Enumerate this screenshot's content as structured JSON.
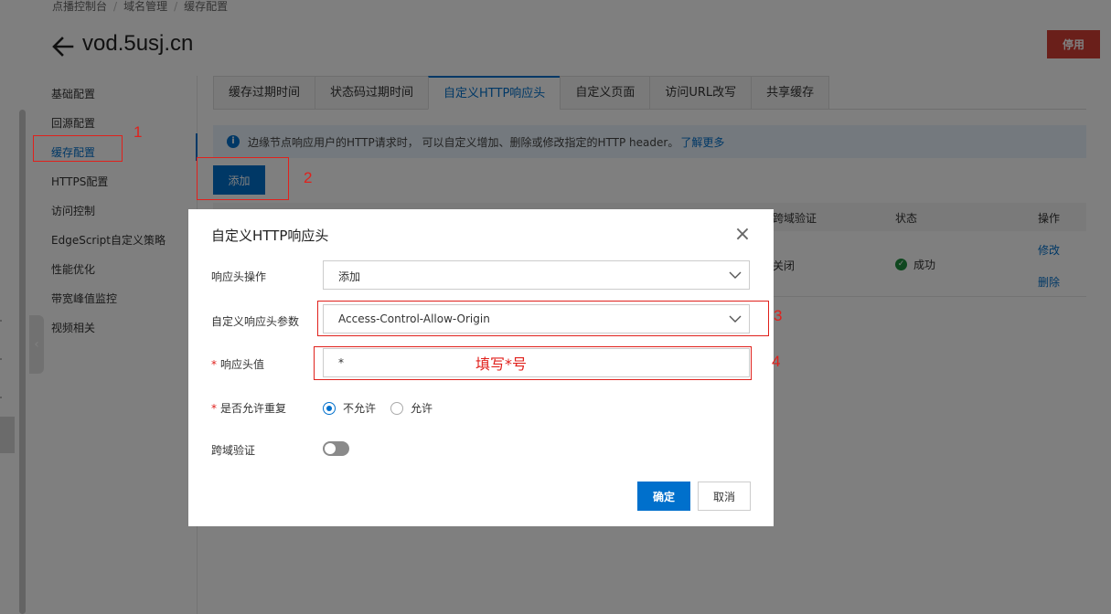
{
  "breadcrumb": [
    "点播控制台",
    "域名管理",
    "缓存配置"
  ],
  "page_title": "vod.5usj.cn",
  "disable_label": "停用",
  "sidebar": {
    "items": [
      {
        "label": "基础配置"
      },
      {
        "label": "回源配置"
      },
      {
        "label": "缓存配置",
        "active": true
      },
      {
        "label": "HTTPS配置"
      },
      {
        "label": "访问控制"
      },
      {
        "label": "EdgeScript自定义策略"
      },
      {
        "label": "性能优化"
      },
      {
        "label": "带宽峰值监控"
      },
      {
        "label": "视频相关"
      }
    ]
  },
  "tabs": [
    {
      "label": "缓存过期时间"
    },
    {
      "label": "状态码过期时间"
    },
    {
      "label": "自定义HTTP响应头",
      "active": true
    },
    {
      "label": "自定义页面"
    },
    {
      "label": "访问URL改写"
    },
    {
      "label": "共享缓存"
    }
  ],
  "info": {
    "text": "边缘节点响应用户的HTTP请求时， 可以自定义增加、删除或修改指定的HTTP header。",
    "link": "了解更多"
  },
  "add_label": "添加",
  "table": {
    "headers": {
      "cors": "跨域验证",
      "status": "状态",
      "actions": "操作"
    },
    "row": {
      "cors": "关闭",
      "status": "成功",
      "edit": "修改",
      "delete": "删除"
    }
  },
  "dialog": {
    "title": "自定义HTTP响应头",
    "operation_label": "响应头操作",
    "operation_value": "添加",
    "param_label": "自定义响应头参数",
    "param_value": "Access-Control-Allow-Origin",
    "value_label": "响应头值",
    "value_value": "*",
    "repeat_label": "是否允许重复",
    "repeat_options": [
      "不允许",
      "允许"
    ],
    "repeat_selected": "不允许",
    "cors_label": "跨域验证",
    "cors_enabled": false,
    "ok_label": "确定",
    "cancel_label": "取消"
  },
  "annotations": {
    "numbers": [
      "1",
      "2",
      "3",
      "4"
    ],
    "hint": "填写*号",
    "color": "#e0211c"
  },
  "colors": {
    "primary": "#0070cc",
    "danger": "#d43f35",
    "success": "#1e8e3e"
  }
}
